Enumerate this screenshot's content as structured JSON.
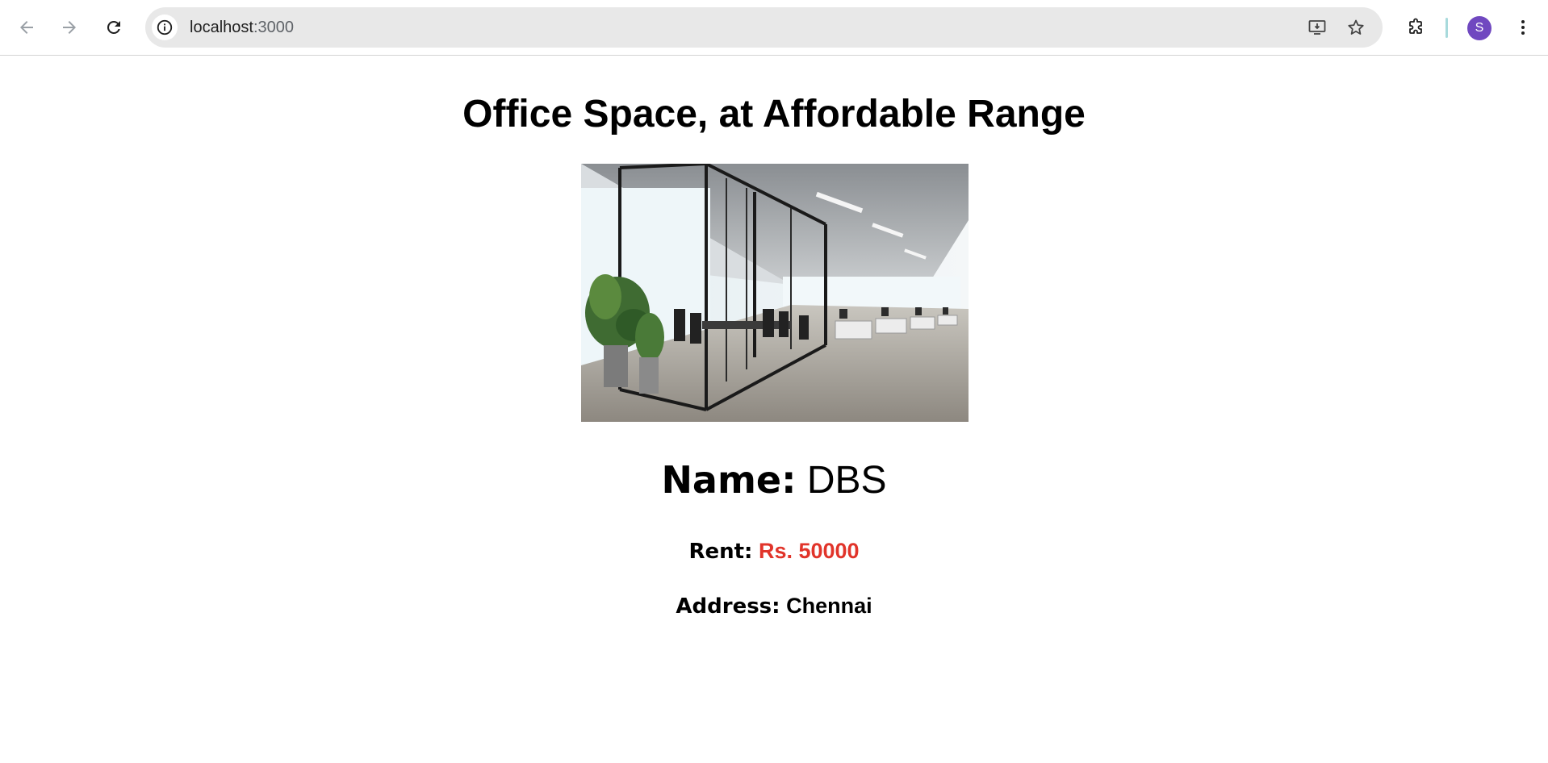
{
  "browser": {
    "url_host": "localhost",
    "url_port": ":3000",
    "profile_initial": "S",
    "icons": {
      "back": "arrow-left-icon",
      "forward": "arrow-right-icon",
      "reload": "reload-icon",
      "site_info": "info-icon",
      "install": "install-app-icon",
      "bookmark": "star-icon",
      "extensions": "puzzle-icon",
      "menu": "kebab-menu-icon"
    },
    "colors": {
      "avatar": "#7048c0",
      "omnibox": "#e8e8e8"
    }
  },
  "page": {
    "title": "Office Space, at Affordable Range",
    "name_label": "Name:",
    "name_value": "DBS",
    "rent_label": "Rent:",
    "rent_value": "Rs. 50000",
    "address_label": "Address:",
    "address_value": "Chennai",
    "colors": {
      "rent_value": "#e1342a"
    }
  }
}
